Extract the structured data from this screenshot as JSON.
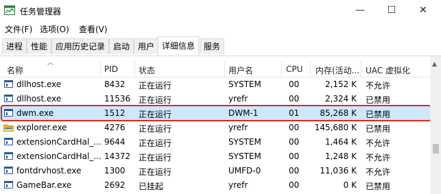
{
  "window": {
    "title": "任务管理器",
    "controls": {
      "minimize": "—",
      "maximize": "☐",
      "close": "✕"
    }
  },
  "menu": [
    "文件(F)",
    "选项(O)",
    "查看(V)"
  ],
  "tabs": [
    {
      "label": "进程",
      "active": false
    },
    {
      "label": "性能",
      "active": false
    },
    {
      "label": "应用历史记录",
      "active": false
    },
    {
      "label": "启动",
      "active": false
    },
    {
      "label": "用户",
      "active": false
    },
    {
      "label": "详细信息",
      "active": true
    },
    {
      "label": "服务",
      "active": false
    }
  ],
  "columns": {
    "name": "名称",
    "pid": "PID",
    "status": "状态",
    "user": "用户名",
    "cpu": "CPU",
    "memory": "内存(活动...",
    "uac": "UAC 虚拟化"
  },
  "rows": [
    {
      "name": "dllhost.exe",
      "pid": "8432",
      "status": "正在运行",
      "user": "SYSTEM",
      "cpu": "00",
      "memory": "2,152 K",
      "uac": "不允许",
      "icon": "process-icon"
    },
    {
      "name": "dllhost.exe",
      "pid": "11536",
      "status": "正在运行",
      "user": "yrefr",
      "cpu": "00",
      "memory": "2,324 K",
      "uac": "已禁用",
      "icon": "process-icon"
    },
    {
      "name": "dwm.exe",
      "pid": "1512",
      "status": "正在运行",
      "user": "DWM-1",
      "cpu": "01",
      "memory": "85,268 K",
      "uac": "已禁用",
      "icon": "process-icon",
      "selected": true
    },
    {
      "name": "explorer.exe",
      "pid": "4276",
      "status": "正在运行",
      "user": "yrefr",
      "cpu": "00",
      "memory": "145,680 K",
      "uac": "已禁用",
      "icon": "folder-icon"
    },
    {
      "name": "extensionCardHal_...",
      "pid": "9644",
      "status": "正在运行",
      "user": "SYSTEM",
      "cpu": "00",
      "memory": "1,464 K",
      "uac": "不允许",
      "icon": "process-icon"
    },
    {
      "name": "extensionCardHal_...",
      "pid": "14372",
      "status": "正在运行",
      "user": "SYSTEM",
      "cpu": "00",
      "memory": "1,248 K",
      "uac": "不允许",
      "icon": "process-icon"
    },
    {
      "name": "fontdrvhost.exe",
      "pid": "1300",
      "status": "正在运行",
      "user": "UMFD-0",
      "cpu": "00",
      "memory": "11,036 K",
      "uac": "不允许",
      "icon": "process-icon"
    },
    {
      "name": "GameBar.exe",
      "pid": "2692",
      "status": "已挂起",
      "user": "yrefr",
      "cpu": "00",
      "memory": "0 K",
      "uac": "已禁用",
      "icon": "process-icon"
    }
  ],
  "colors": {
    "selected_row": "#cce8ff",
    "highlight_border": "#e0271e",
    "icon_blue": "#2b5797"
  }
}
